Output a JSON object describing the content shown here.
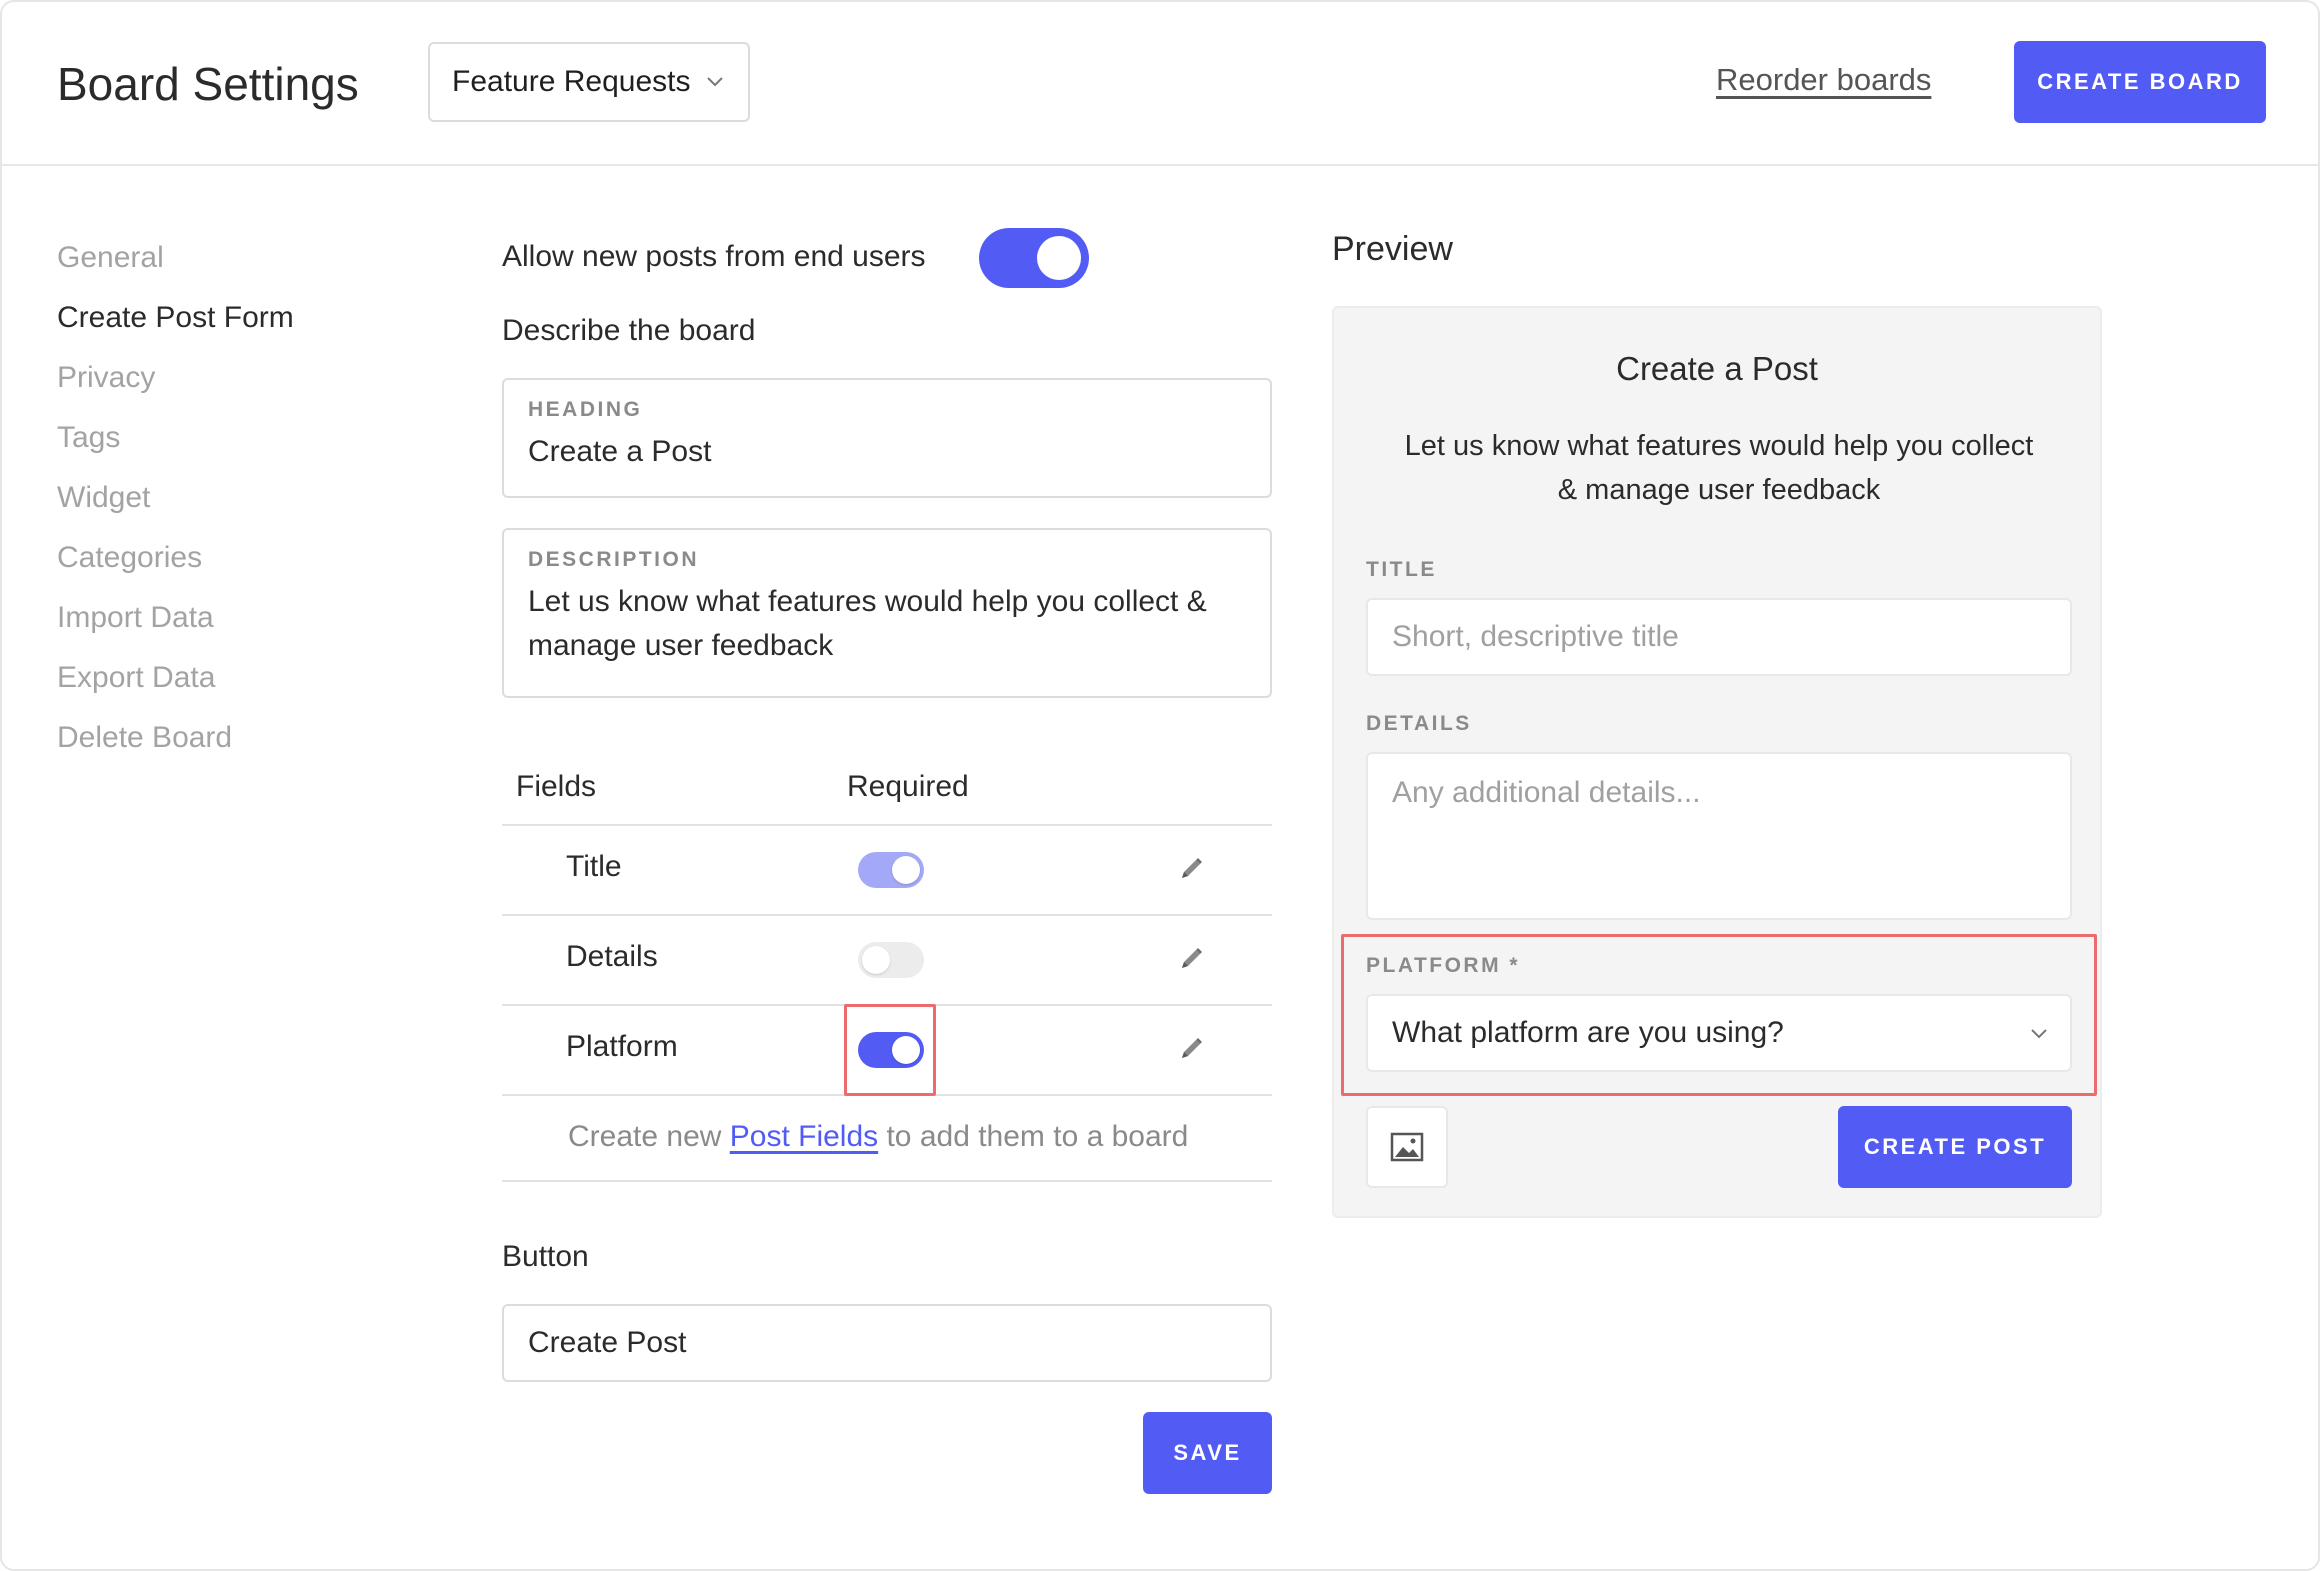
{
  "header": {
    "title": "Board Settings",
    "board_select": "Feature Requests",
    "reorder_link": "Reorder boards",
    "create_board_button": "CREATE BOARD"
  },
  "sidebar": {
    "items": [
      {
        "label": "General",
        "active": false
      },
      {
        "label": "Create Post Form",
        "active": true
      },
      {
        "label": "Privacy",
        "active": false
      },
      {
        "label": "Tags",
        "active": false
      },
      {
        "label": "Widget",
        "active": false
      },
      {
        "label": "Categories",
        "active": false
      },
      {
        "label": "Import Data",
        "active": false
      },
      {
        "label": "Export Data",
        "active": false
      },
      {
        "label": "Delete Board",
        "active": false
      }
    ]
  },
  "form": {
    "allow_new_posts_label": "Allow new posts from end users",
    "allow_new_posts_on": true,
    "describe_label": "Describe the board",
    "heading": {
      "label": "HEADING",
      "value": "Create a Post"
    },
    "description": {
      "label": "DESCRIPTION",
      "value": "Let us know what features would help you collect & manage user feedback"
    },
    "fields_header": {
      "fields": "Fields",
      "required": "Required"
    },
    "fields": [
      {
        "name": "Title",
        "required": true
      },
      {
        "name": "Details",
        "required": false
      },
      {
        "name": "Platform",
        "required": true
      }
    ],
    "post_fields_note": {
      "before": "Create new ",
      "link": "Post Fields",
      "after": " to add them to a board"
    },
    "button_label": "Button",
    "button_value": "Create Post",
    "save_button": "SAVE"
  },
  "preview": {
    "label": "Preview",
    "title": "Create a Post",
    "description": "Let us know what features would help you collect & manage user feedback",
    "title_field": {
      "label": "TITLE",
      "placeholder": "Short, descriptive title"
    },
    "details_field": {
      "label": "DETAILS",
      "placeholder": "Any additional details..."
    },
    "platform_field": {
      "label": "PLATFORM *",
      "placeholder": "What platform are you using?"
    },
    "create_post_button": "CREATE POST"
  },
  "colors": {
    "accent": "#525cf5",
    "highlight": "#ec6b6b",
    "muted_text": "#a3a3a3"
  }
}
